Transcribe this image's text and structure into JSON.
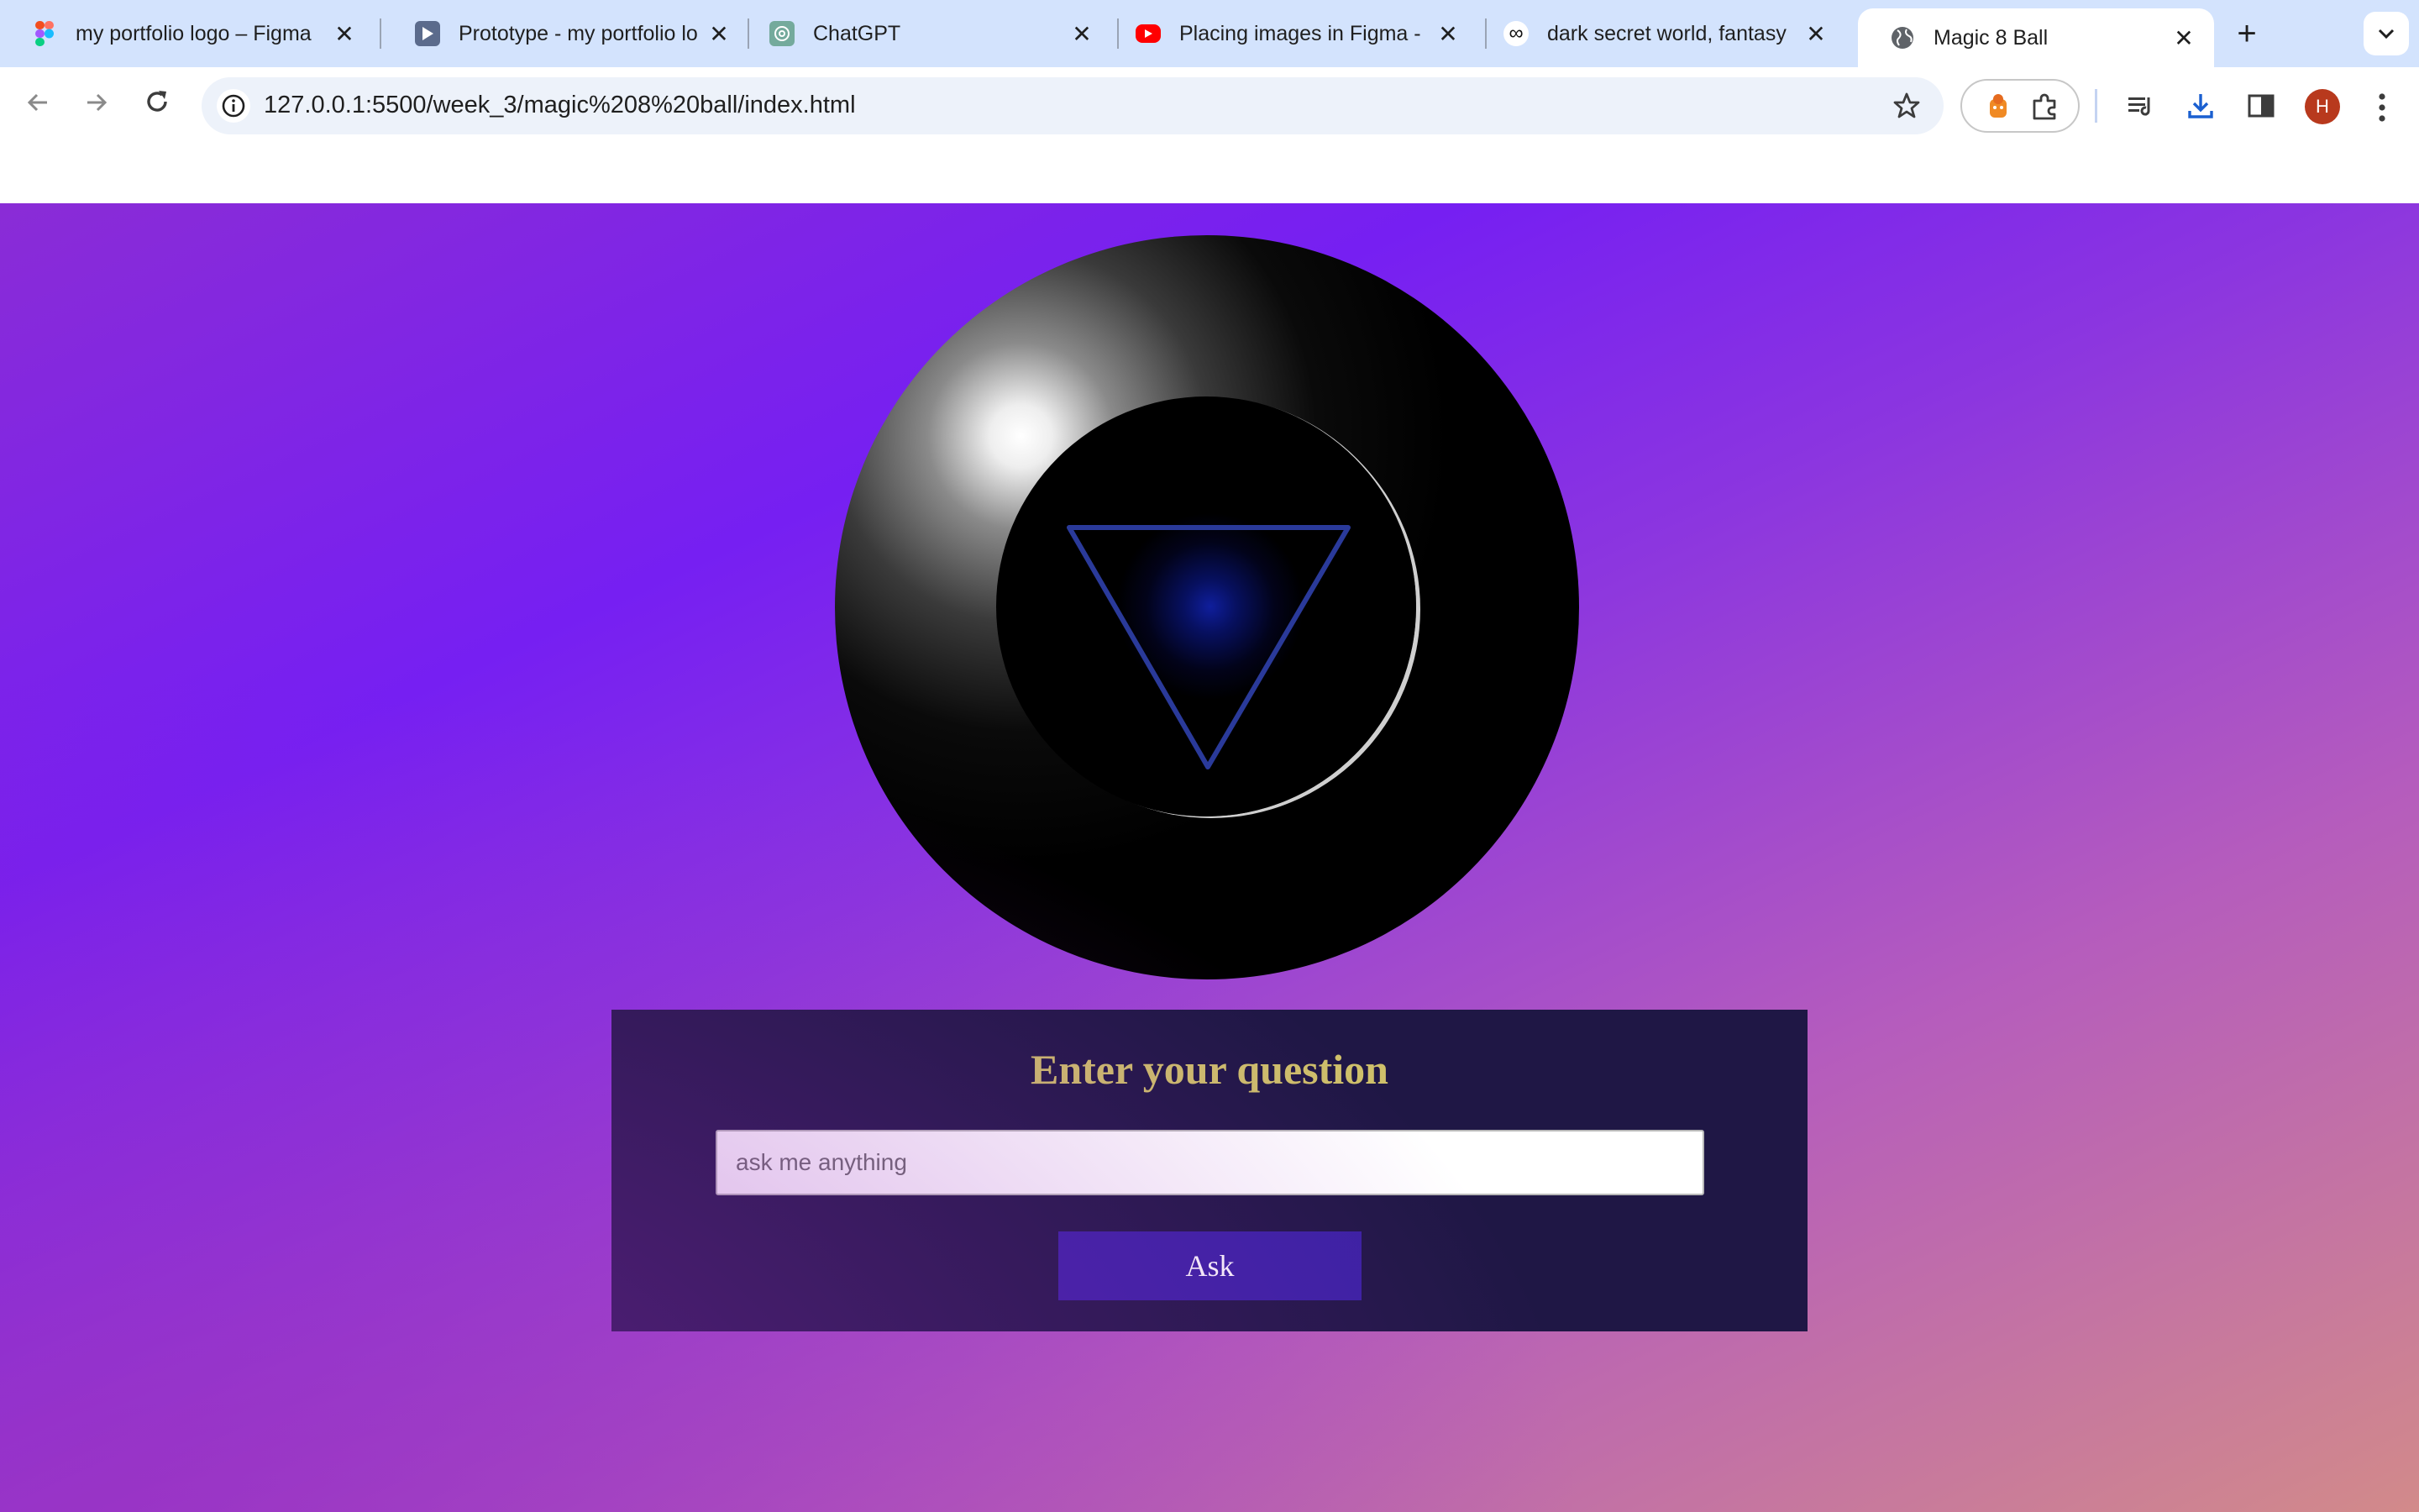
{
  "browser": {
    "tabs": [
      {
        "title": "my portfolio logo – Figma",
        "icon": "figma-icon",
        "active": false
      },
      {
        "title": "Prototype - my portfolio lo",
        "icon": "figma-prototype-icon",
        "active": false
      },
      {
        "title": "ChatGPT",
        "icon": "chatgpt-icon",
        "active": false
      },
      {
        "title": "Placing images in Figma -",
        "icon": "youtube-icon",
        "active": false
      },
      {
        "title": "dark secret world, fantasy",
        "icon": "infinity-icon",
        "active": false
      },
      {
        "title": "Magic 8 Ball",
        "icon": "globe-icon",
        "active": true
      }
    ],
    "address_bar": {
      "url": "127.0.0.1:5500/week_3/magic%208%20ball/index.html"
    },
    "profile_initial": "H"
  },
  "page": {
    "heading": "Enter your question",
    "input": {
      "placeholder": "ask me anything",
      "value": ""
    },
    "ask_button": "Ask"
  },
  "colors": {
    "heading": "#cfc06a",
    "panel_bg": "#1f1745",
    "button_bg": "#3a21a3",
    "triangle": "#2a3a9a"
  }
}
